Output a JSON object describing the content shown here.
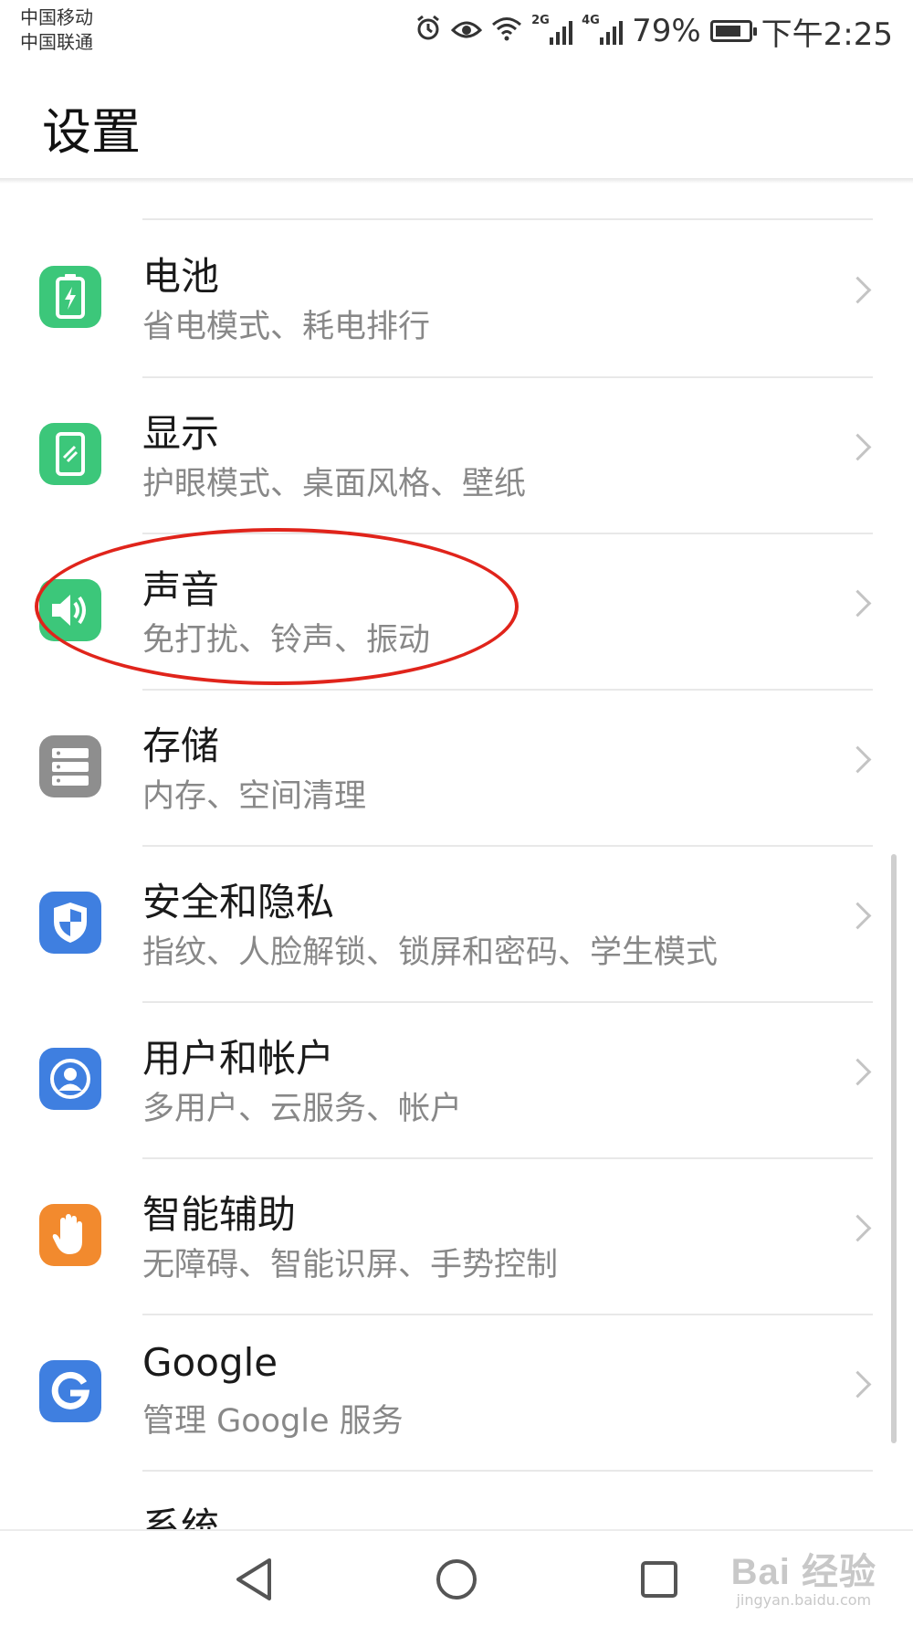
{
  "status_bar": {
    "carrier_1": "中国移动",
    "carrier_2": "中国联通",
    "network_1": "2G",
    "network_2": "4G",
    "battery_percent": "79%",
    "battery_level": 0.79,
    "time": "下午2:25",
    "icons": [
      "alarm-icon",
      "eye-comfort-icon",
      "wifi-icon",
      "signal-icon",
      "battery-icon"
    ]
  },
  "header": {
    "title": "设置"
  },
  "list": {
    "items": [
      {
        "title": "电池",
        "subtitle": "省电模式、耗电排行",
        "icon": "battery-icon",
        "color": "#3cc77a"
      },
      {
        "title": "显示",
        "subtitle": "护眼模式、桌面风格、壁纸",
        "icon": "display-icon",
        "color": "#3cc77a"
      },
      {
        "title": "声音",
        "subtitle": "免打扰、铃声、振动",
        "icon": "sound-icon",
        "color": "#3cc77a"
      },
      {
        "title": "存储",
        "subtitle": "内存、空间清理",
        "icon": "storage-icon",
        "color": "#8e8e8e"
      },
      {
        "title": "安全和隐私",
        "subtitle": "指纹、人脸解锁、锁屏和密码、学生模式",
        "icon": "shield-icon",
        "color": "#3f7fe0"
      },
      {
        "title": "用户和帐户",
        "subtitle": "多用户、云服务、帐户",
        "icon": "user-icon",
        "color": "#3f7fe0"
      },
      {
        "title": "智能辅助",
        "subtitle": "无障碍、智能识屏、手势控制",
        "icon": "hand-icon",
        "color": "#f28a2e"
      },
      {
        "title": "Google",
        "subtitle": "管理 Google 服务",
        "icon": "google-icon",
        "color": "#3f7fe0"
      },
      {
        "title": "系统",
        "subtitle": "",
        "icon": "",
        "color": ""
      }
    ],
    "highlight_color": "#e0241b"
  },
  "nav": {
    "icons": [
      "back-icon",
      "home-icon",
      "recents-icon"
    ]
  },
  "watermark": {
    "logo": "Bai 经验",
    "url": "jingyan.baidu.com"
  }
}
